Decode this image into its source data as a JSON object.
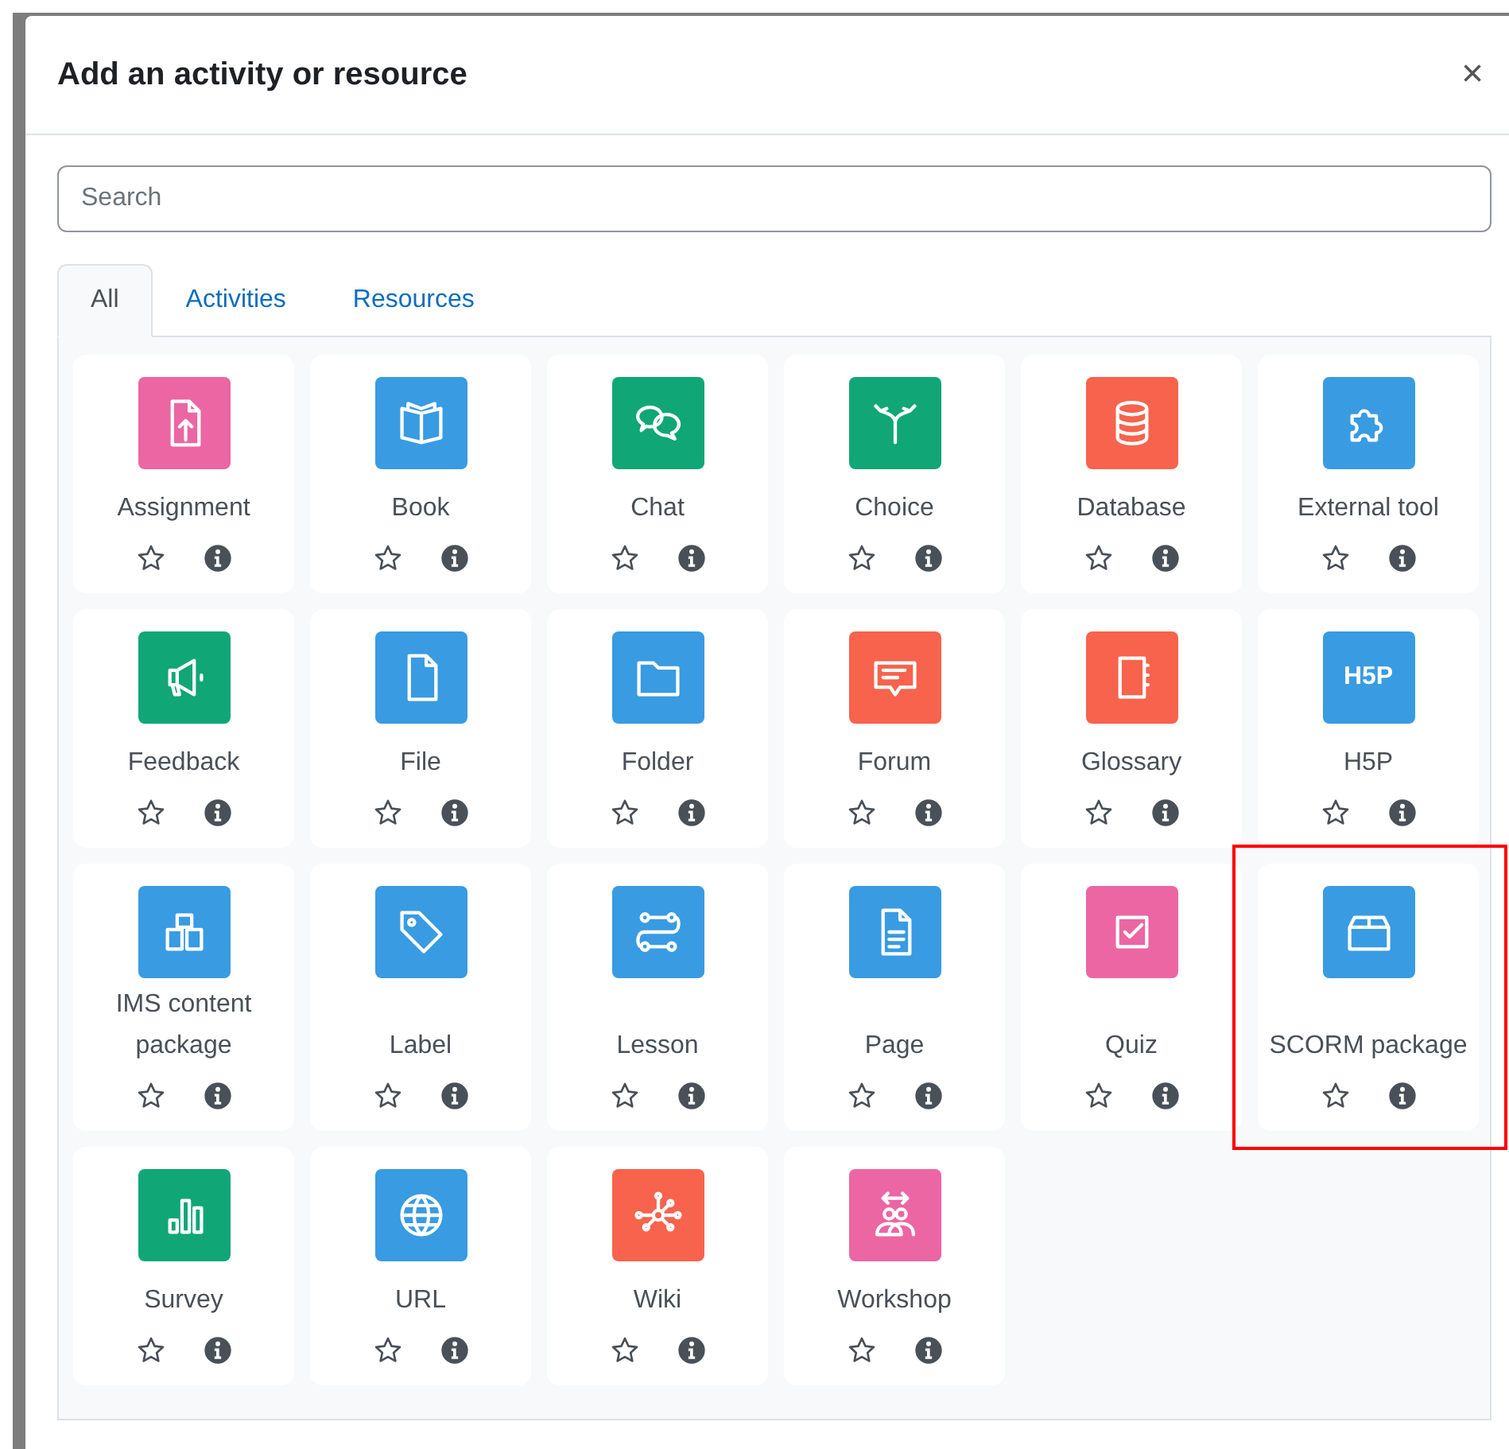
{
  "dialog": {
    "title": "Add an activity or resource",
    "close": "×"
  },
  "search": {
    "placeholder": "Search"
  },
  "tabs": [
    {
      "label": "All",
      "selected": true
    },
    {
      "label": "Activities",
      "selected": false
    },
    {
      "label": "Resources",
      "selected": false
    }
  ],
  "items": [
    {
      "label": "Assignment",
      "color": "#eb66a2",
      "starred": false,
      "highlighted": false
    },
    {
      "label": "Book",
      "color": "#399be2",
      "starred": false,
      "highlighted": false
    },
    {
      "label": "Chat",
      "color": "#11a676",
      "starred": false,
      "highlighted": false
    },
    {
      "label": "Choice",
      "color": "#11a676",
      "starred": false,
      "highlighted": false
    },
    {
      "label": "Database",
      "color": "#f7634d",
      "starred": false,
      "highlighted": false
    },
    {
      "label": "External tool",
      "color": "#399be2",
      "starred": false,
      "highlighted": false
    },
    {
      "label": "Feedback",
      "color": "#11a676",
      "starred": false,
      "highlighted": false
    },
    {
      "label": "File",
      "color": "#399be2",
      "starred": false,
      "highlighted": false
    },
    {
      "label": "Folder",
      "color": "#399be2",
      "starred": false,
      "highlighted": false
    },
    {
      "label": "Forum",
      "color": "#f7634d",
      "starred": false,
      "highlighted": false
    },
    {
      "label": "Glossary",
      "color": "#f7634d",
      "starred": false,
      "highlighted": false
    },
    {
      "label": "H5P",
      "color": "#399be2",
      "starred": false,
      "highlighted": false,
      "icon_text": "H5P"
    },
    {
      "label": "IMS content package",
      "color": "#399be2",
      "starred": false,
      "highlighted": false
    },
    {
      "label": "Label",
      "color": "#399be2",
      "starred": false,
      "highlighted": false
    },
    {
      "label": "Lesson",
      "color": "#399be2",
      "starred": false,
      "highlighted": false
    },
    {
      "label": "Page",
      "color": "#399be2",
      "starred": false,
      "highlighted": false
    },
    {
      "label": "Quiz",
      "color": "#eb66a2",
      "starred": false,
      "highlighted": false
    },
    {
      "label": "SCORM package",
      "color": "#399be2",
      "starred": false,
      "highlighted": true
    },
    {
      "label": "Survey",
      "color": "#11a676",
      "starred": false,
      "highlighted": false
    },
    {
      "label": "URL",
      "color": "#399be2",
      "starred": false,
      "highlighted": false
    },
    {
      "label": "Wiki",
      "color": "#f7634d",
      "starred": false,
      "highlighted": false
    },
    {
      "label": "Workshop",
      "color": "#eb66a2",
      "starred": false,
      "highlighted": false
    }
  ]
}
